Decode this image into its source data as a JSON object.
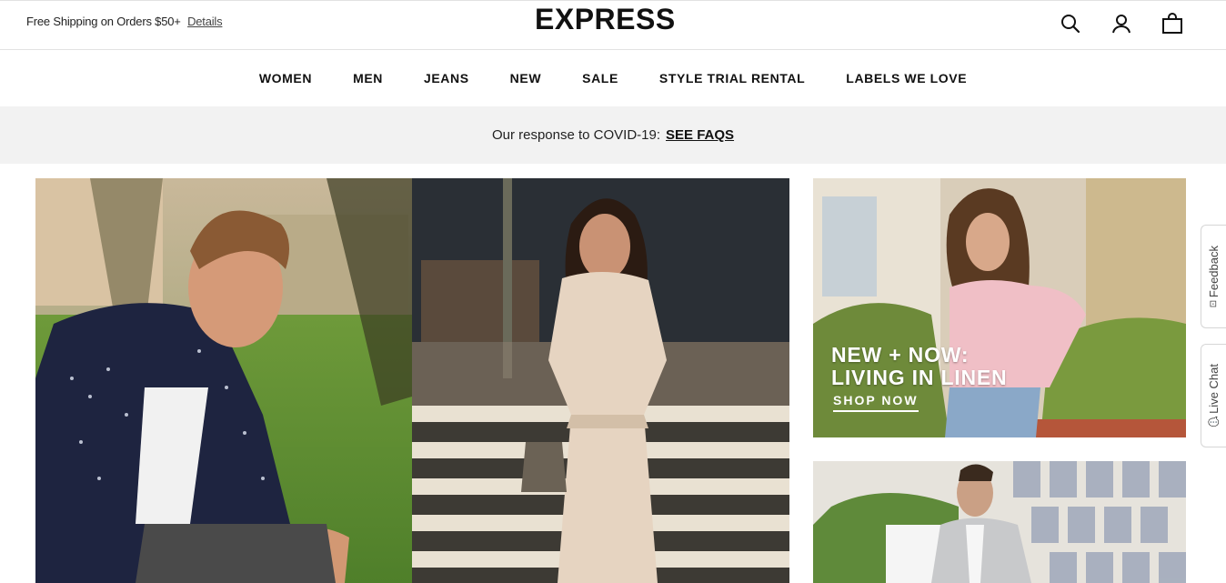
{
  "header": {
    "promo_text": "Free Shipping on Orders $50+",
    "promo_link": "Details",
    "logo": "EXPRESS",
    "icons": [
      "search-icon",
      "account-icon",
      "bag-icon"
    ]
  },
  "nav": {
    "items": [
      "WOMEN",
      "MEN",
      "JEANS",
      "NEW",
      "SALE",
      "STYLE TRIAL RENTAL",
      "LABELS WE LOVE"
    ]
  },
  "covid_banner": {
    "text": "Our response to COVID-19:",
    "link": "SEE FAQS"
  },
  "tiles": {
    "linen_headline_line1": "NEW + NOW:",
    "linen_headline_line2": "LIVING IN LINEN",
    "linen_cta": "SHOP NOW"
  },
  "side_tabs": {
    "feedback": "Feedback",
    "live_chat": "Live Chat"
  },
  "colors": {
    "banner_bg": "#f2f2f2",
    "text": "#111111"
  }
}
